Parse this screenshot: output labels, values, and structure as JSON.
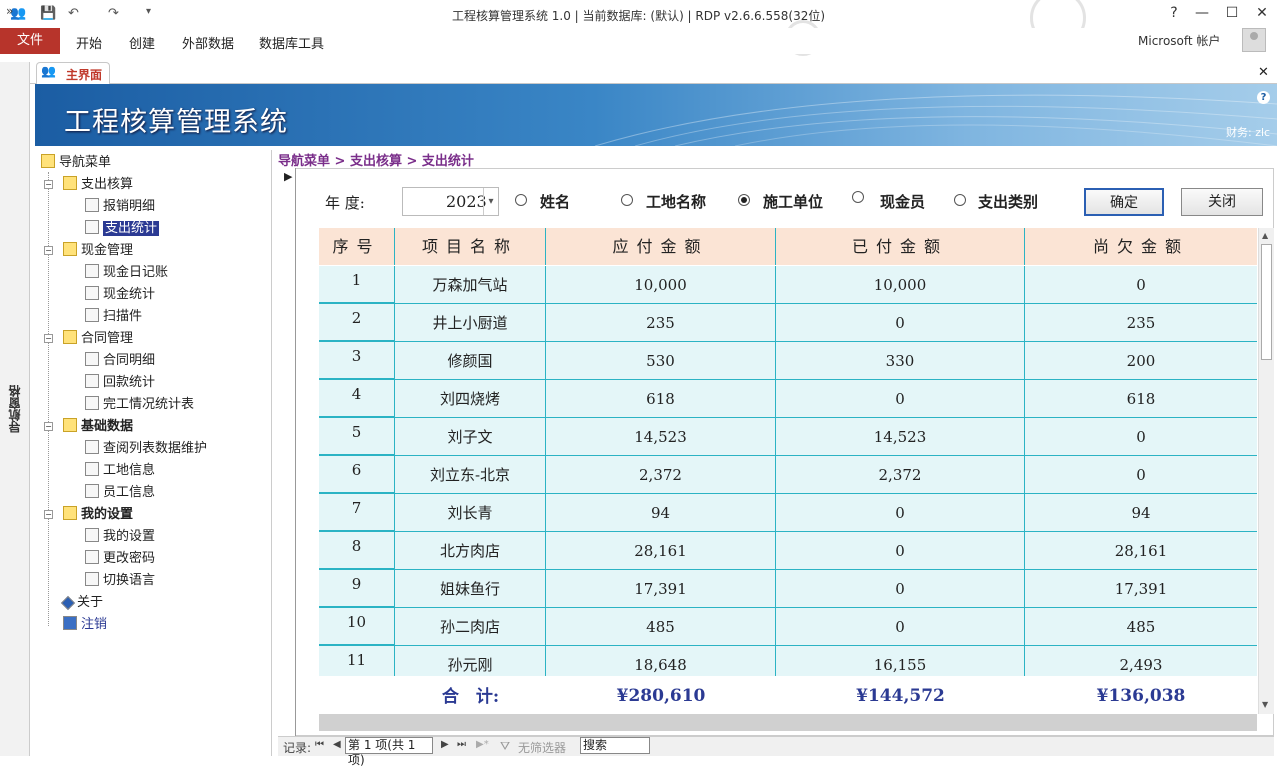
{
  "window": {
    "title": "工程核算管理系统 1.0 | 当前数据库: (默认) | RDP v2.6.6.558(32位)",
    "help": "?",
    "minimize": "—",
    "maximize": "☐",
    "close": "✕"
  },
  "ribbon": {
    "tabs": [
      "文件",
      "开始",
      "创建",
      "外部数据",
      "数据库工具"
    ],
    "account": "Microsoft 帐户"
  },
  "navpane": {
    "label": "导航窗格",
    "toggle": "»"
  },
  "doc": {
    "tab": "主界面",
    "close": "✕"
  },
  "banner": {
    "title": "工程核算管理系统",
    "user": "财务: zlc"
  },
  "tree": {
    "root": "导航菜单",
    "groups": [
      {
        "label": "支出核算",
        "items": [
          "报销明细",
          "支出统计"
        ]
      },
      {
        "label": "现金管理",
        "items": [
          "现金日记账",
          "现金统计",
          "扫描件"
        ]
      },
      {
        "label": "合同管理",
        "items": [
          "合同明细",
          "回款统计",
          "完工情况统计表"
        ]
      },
      {
        "label": "基础数据",
        "items": [
          "查阅列表数据维护",
          "工地信息",
          "员工信息"
        ]
      },
      {
        "label": "我的设置",
        "items": [
          "我的设置",
          "更改密码",
          "切换语言"
        ]
      }
    ],
    "about": "关于",
    "logout": "注销"
  },
  "breadcrumb": "导航菜单 > 支出核算 > 支出统计",
  "form": {
    "year_label": "年 度:",
    "year_value": "2023",
    "radios": [
      "姓名",
      "工地名称",
      "施工单位",
      "现金员",
      "支出类别"
    ],
    "selected_radio": "施工单位",
    "ok": "确定",
    "close": "关闭"
  },
  "table": {
    "headers": [
      "序号",
      "项目名称",
      "应付金额",
      "已付金额",
      "尚欠金额"
    ],
    "rows": [
      [
        "1",
        "万森加气站",
        "10,000",
        "10,000",
        "0"
      ],
      [
        "2",
        "井上小厨道",
        "235",
        "0",
        "235"
      ],
      [
        "3",
        "修颜国",
        "530",
        "330",
        "200"
      ],
      [
        "4",
        "刘四烧烤",
        "618",
        "0",
        "618"
      ],
      [
        "5",
        "刘子文",
        "14,523",
        "14,523",
        "0"
      ],
      [
        "6",
        "刘立东-北京",
        "2,372",
        "2,372",
        "0"
      ],
      [
        "7",
        "刘长青",
        "94",
        "0",
        "94"
      ],
      [
        "8",
        "北方肉店",
        "28,161",
        "0",
        "28,161"
      ],
      [
        "9",
        "姐妹鱼行",
        "17,391",
        "0",
        "17,391"
      ],
      [
        "10",
        "孙二肉店",
        "485",
        "0",
        "485"
      ],
      [
        "11",
        "孙元刚",
        "18,648",
        "16,155",
        "2,493"
      ]
    ],
    "total_label": "合　计:",
    "totals": [
      "¥280,610",
      "¥144,572",
      "¥136,038"
    ]
  },
  "statusbar": {
    "record_label": "记录:",
    "record_value": "第 1 项(共 1 项)",
    "filter": "无筛选器",
    "search": "搜索"
  }
}
